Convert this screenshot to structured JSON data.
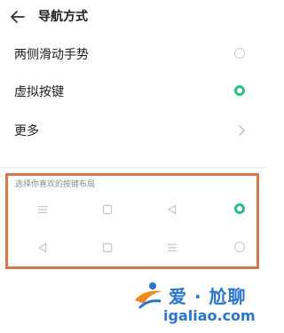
{
  "header": {
    "title": "导航方式",
    "back_icon": "arrow-left-icon"
  },
  "options": [
    {
      "label": "两侧滑动手势",
      "selected": false
    },
    {
      "label": "虚拟按键",
      "selected": true
    }
  ],
  "more": {
    "label": "更多",
    "icon": "chevron-right-icon"
  },
  "layout_section": {
    "label": "选择你喜欢的按键布局",
    "layouts": [
      {
        "keys": [
          "menu-icon",
          "square-icon",
          "triangle-left-icon"
        ],
        "selected": true
      },
      {
        "keys": [
          "triangle-left-icon",
          "square-icon",
          "menu-icon"
        ],
        "selected": false
      }
    ]
  },
  "watermark": {
    "title": "爱 · 尬聊",
    "url": "igaliao.com"
  },
  "colors": {
    "accent": "#2dbf7f",
    "highlight_border": "#d8764e",
    "watermark": "#2a74c9"
  }
}
